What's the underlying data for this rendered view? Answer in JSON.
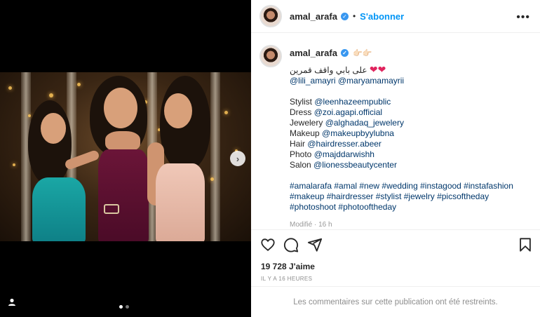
{
  "post": {
    "username": "amal_arafa",
    "separator": "•",
    "follow_label": "S'abonner",
    "more_label": "•••",
    "caption": {
      "emoji_hands": "👉🏻👉🏻",
      "line_arabic": "على بابي واقف قمرين",
      "hearts": "❤❤",
      "mentions_1": [
        "@lili_amayri",
        "@maryamamayrii"
      ],
      "credits": [
        {
          "label": "Stylist",
          "handle": "@leenhazeempublic"
        },
        {
          "label": "Dress",
          "handle": "@zoi.agapi.official"
        },
        {
          "label": "Jewelery",
          "handle": "@alghadaq_jewelery"
        },
        {
          "label": "Makeup",
          "handle": "@makeupbyylubna"
        },
        {
          "label": "Hair",
          "handle": "@hairdresser.abeer"
        },
        {
          "label": "Photo",
          "handle": "@majddarwishh"
        },
        {
          "label": "Salon",
          "handle": "@lionessbeautycenter"
        }
      ],
      "hashtags_line1": "#amalarafa #amal #new #wedding #instagood #instafashion",
      "hashtags_line2": "#makeup #hairdresser #stylist #jewelry #picsoftheday",
      "hashtags_line3": "#photoshoot #photooftheday",
      "modified": "Modifié · 16 h"
    },
    "likes": "19 728 J'aime",
    "timestamp": "IL Y A 16 HEURES",
    "comments_restricted": "Les commentaires sur cette publication ont été restreints."
  },
  "media": {
    "next_icon": "chevron-right-icon",
    "carousel_dots": 2,
    "active_dot": 0
  },
  "colors": {
    "link": "#00376b",
    "follow": "#0095f6",
    "verified": "#3897f0"
  }
}
